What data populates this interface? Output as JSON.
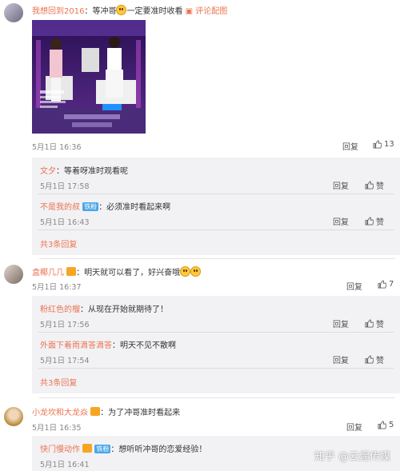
{
  "comments": [
    {
      "user": "我想回到2016",
      "text": "：等冲哥",
      "text_after": "一定要准时收看",
      "link": "评论配图",
      "time": "5月1日 16:36",
      "reply_label": "回复",
      "likes": "13",
      "replies": [
        {
          "user": "文夕",
          "text": "：等着呀准时观看呢",
          "time": "5月1日 17:58",
          "reply_label": "回复",
          "like_label": "赞"
        },
        {
          "user": "不是我的叔",
          "badge": "铁粉",
          "text": "：必须准时看起来啊",
          "time": "5月1日 16:43",
          "reply_label": "回复",
          "like_label": "赞"
        }
      ],
      "more": "共3条回复"
    },
    {
      "user": "盒椰几几",
      "text": "：明天就可以看了，好兴奋哦",
      "time": "5月1日 16:37",
      "reply_label": "回复",
      "likes": "7",
      "replies": [
        {
          "user": "粉红色的榴",
          "text": "：从现在开始就期待了！",
          "time": "5月1日 17:56",
          "reply_label": "回复",
          "like_label": "赞"
        },
        {
          "user": "外面下着雨滴答滴答",
          "text": "：明天不见不散啊",
          "time": "5月1日 17:54",
          "reply_label": "回复",
          "like_label": "赞"
        }
      ],
      "more": "共3条回复"
    },
    {
      "user": "小龙坎和大龙焱",
      "text": "：为了冲哥准时看起来",
      "time": "5月1日 16:35",
      "reply_label": "回复",
      "likes": "5",
      "replies": [
        {
          "user": "快门慢动作",
          "badge": "铁粉",
          "text": "：想听听冲哥的恋爱经验！",
          "time": "5月1日 16:41"
        }
      ]
    }
  ],
  "watermark": "知乎 @云煋传媒",
  "colors": {
    "accent": "#eb7350",
    "reply_bg": "#f2f2f5",
    "badge": "#4aa6e8"
  }
}
